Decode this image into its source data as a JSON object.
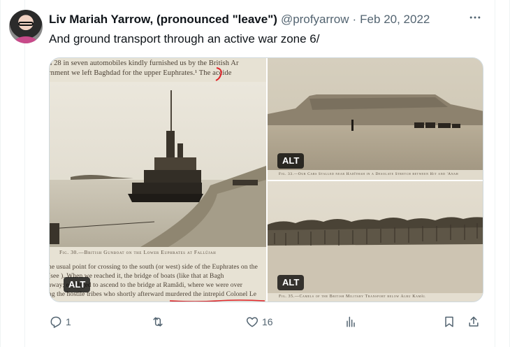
{
  "author": {
    "name": "Liv Mariah Yarrow, (pronounced \"leave\")",
    "handle": "@profyarrow",
    "separator": "·",
    "date": "Feb 20, 2022"
  },
  "tweet": {
    "text": "And ground transport through an active war zone 6/"
  },
  "icons": {
    "more": "more-horizontal-icon",
    "reply": "reply-icon",
    "retweet": "retweet-icon",
    "like": "heart-icon",
    "views": "views-chart-icon",
    "bookmark": "bookmark-icon",
    "share": "share-icon"
  },
  "media": {
    "left": {
      "page_text_top": [
        "n 28 in seven automobiles kindly furnished us by the British Ar",
        "rnment we left Baghdad for the upper Euphrates.¹ The accide"
      ],
      "caption": "Fig. 30.—British Gunboat on the Lower Euphrates at Fallûjah",
      "page_text_bottom": [
        "he usual point for crossing to the south (or west) side of the Euphrates on the",
        "(see         ). When we reached it, the bridge of boats (like that at Bagh",
        "away;       e obliged to ascend to the bridge at Ramâdi, where we were over",
        "ng the hostile tribes who shortly afterward murdered the intrepid Colonel Le"
      ],
      "alt": "ALT"
    },
    "top_right": {
      "caption": "Fig. 33.—Our Cars Stalled near Hadîthah in a Desolate Stretch between Hit and 'Anah",
      "alt": "ALT"
    },
    "bottom_right": {
      "caption": "Fig. 35.—Camels of the British Military Transport below Albu Kamâl",
      "alt": "ALT"
    },
    "annotation_color": "#e0242a"
  },
  "actions": {
    "reply_count": "1",
    "retweet_count": "",
    "like_count": "16"
  }
}
